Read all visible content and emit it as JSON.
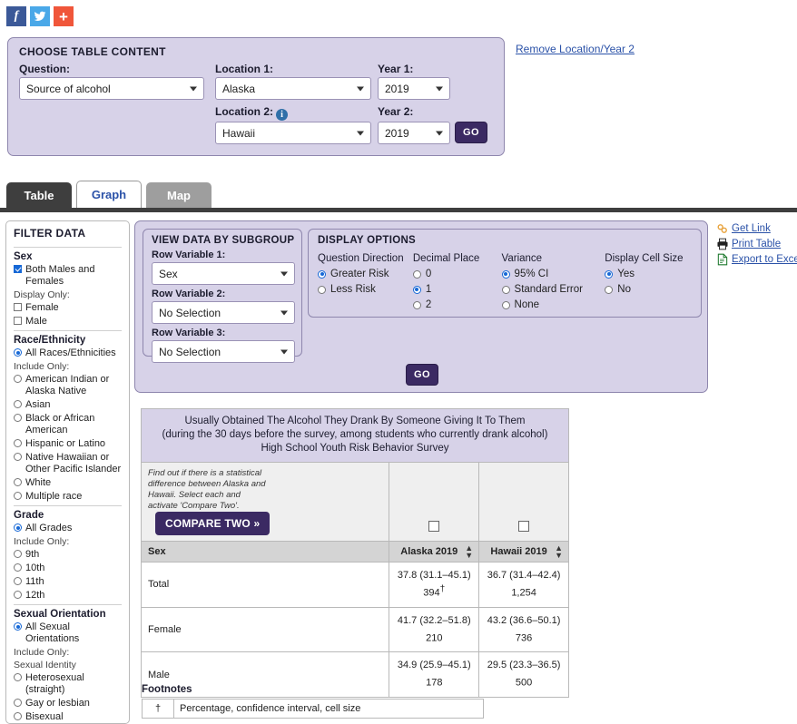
{
  "social": [
    {
      "name": "facebook-share",
      "label": "f"
    },
    {
      "name": "twitter-share",
      "label": "t"
    },
    {
      "name": "more-share",
      "label": "+"
    }
  ],
  "choose_panel": {
    "title": "CHOOSE TABLE CONTENT",
    "question_label": "Question:",
    "question_value": "Source of alcohol",
    "location1_label": "Location 1:",
    "location1_value": "Alaska",
    "year1_label": "Year 1:",
    "year1_value": "2019",
    "location2_label": "Location 2:",
    "location2_info": "i",
    "location2_value": "Hawaii",
    "year2_label": "Year 2:",
    "year2_value": "2019",
    "go_label": "GO",
    "remove_link": "Remove Location/Year 2"
  },
  "tabs": [
    {
      "label": "Table",
      "state": "active-dark"
    },
    {
      "label": "Graph",
      "state": "current"
    },
    {
      "label": "Map",
      "state": "gray"
    }
  ],
  "filter": {
    "title": "FILTER DATA",
    "groups": [
      {
        "title": "Sex",
        "primary": {
          "label": "Both Males and Females",
          "type": "check",
          "on": true
        },
        "note": "Display Only:",
        "options": [
          {
            "label": "Female",
            "type": "check",
            "on": false
          },
          {
            "label": "Male",
            "type": "check",
            "on": false
          }
        ]
      },
      {
        "title": "Race/Ethnicity",
        "primary": {
          "label": "All Races/Ethnicities",
          "type": "radio",
          "on": true
        },
        "note": "Include Only:",
        "options": [
          {
            "label": "American Indian or Alaska Native",
            "type": "radio",
            "on": false
          },
          {
            "label": "Asian",
            "type": "radio",
            "on": false
          },
          {
            "label": "Black or African American",
            "type": "radio",
            "on": false
          },
          {
            "label": "Hispanic or Latino",
            "type": "radio",
            "on": false
          },
          {
            "label": "Native Hawaiian or Other Pacific Islander",
            "type": "radio",
            "on": false
          },
          {
            "label": "White",
            "type": "radio",
            "on": false
          },
          {
            "label": "Multiple race",
            "type": "radio",
            "on": false
          }
        ]
      },
      {
        "title": "Grade",
        "primary": {
          "label": "All Grades",
          "type": "radio",
          "on": true
        },
        "note": "Include Only:",
        "options": [
          {
            "label": "9th",
            "type": "radio",
            "on": false
          },
          {
            "label": "10th",
            "type": "radio",
            "on": false
          },
          {
            "label": "11th",
            "type": "radio",
            "on": false
          },
          {
            "label": "12th",
            "type": "radio",
            "on": false
          }
        ]
      },
      {
        "title": "Sexual Orientation",
        "primary": {
          "label": "All Sexual Orientations",
          "type": "radio",
          "on": true
        },
        "note": "Include Only:",
        "note2": "Sexual Identity",
        "options": [
          {
            "label": "Heterosexual (straight)",
            "type": "radio",
            "on": false
          },
          {
            "label": "Gay or lesbian",
            "type": "radio",
            "on": false
          },
          {
            "label": "Bisexual",
            "type": "radio",
            "on": false
          }
        ]
      }
    ]
  },
  "subgroup": {
    "title": "VIEW DATA BY SUBGROUP",
    "rv1_label": "Row Variable 1:",
    "rv1_value": "Sex",
    "rv2_label": "Row Variable 2:",
    "rv2_value": "No Selection",
    "rv3_label": "Row Variable 3:",
    "rv3_value": "No Selection"
  },
  "display_options": {
    "title": "DISPLAY OPTIONS",
    "columns": [
      {
        "head": "Question Direction",
        "options": [
          {
            "label": "Greater Risk",
            "on": true
          },
          {
            "label": "Less Risk",
            "on": false
          }
        ]
      },
      {
        "head": "Decimal Place",
        "options": [
          {
            "label": "0",
            "on": false
          },
          {
            "label": "1",
            "on": true
          },
          {
            "label": "2",
            "on": false
          }
        ]
      },
      {
        "head": "Variance",
        "options": [
          {
            "label": "95% CI",
            "on": true
          },
          {
            "label": "Standard Error",
            "on": false
          },
          {
            "label": "None",
            "on": false
          }
        ]
      },
      {
        "head": "Display Cell Size",
        "options": [
          {
            "label": "Yes",
            "on": true
          },
          {
            "label": "No",
            "on": false
          }
        ]
      }
    ],
    "go_label": "GO"
  },
  "right_links": [
    {
      "label": "Get Link",
      "icon": "link-icon"
    },
    {
      "label": "Print Table",
      "icon": "printer-icon"
    },
    {
      "label": "Export to Excel",
      "icon": "document-icon"
    }
  ],
  "results": {
    "title_line1": "Usually Obtained The Alcohol They Drank By Someone Giving It To Them",
    "title_line2": "(during the 30 days before the survey, among students who currently drank alcohol)",
    "title_line3": "High School Youth Risk Behavior Survey",
    "compare_note": "Find out if there is a statistical difference between Alaska and Hawaii. Select each and activate 'Compare Two'.",
    "compare_button": "COMPARE TWO »",
    "row_header": "Sex",
    "columns": [
      "Alaska 2019",
      "Hawaii 2019"
    ],
    "rows": [
      {
        "label": "Total",
        "cells": [
          {
            "value": "37.8 (31.1–45.1)",
            "size": "394",
            "dagger": "†"
          },
          {
            "value": "36.7 (31.4–42.4)",
            "size": "1,254",
            "dagger": ""
          }
        ]
      },
      {
        "label": "Female",
        "cells": [
          {
            "value": "41.7 (32.2–51.8)",
            "size": "210",
            "dagger": ""
          },
          {
            "value": "43.2 (36.6–50.1)",
            "size": "736",
            "dagger": ""
          }
        ]
      },
      {
        "label": "Male",
        "cells": [
          {
            "value": "34.9 (25.9–45.1)",
            "size": "178",
            "dagger": ""
          },
          {
            "value": "29.5 (23.3–36.5)",
            "size": "500",
            "dagger": ""
          }
        ]
      }
    ]
  },
  "footnotes": {
    "title": "Footnotes",
    "rows": [
      {
        "symbol": "†",
        "text": "Percentage, confidence interval, cell size"
      }
    ]
  },
  "colors": {
    "panel_purple": "#d7d2e8",
    "accent_dark_purple": "#3b2a63",
    "link_blue": "#2b52a8",
    "tab_dark": "#3e3e3e"
  }
}
